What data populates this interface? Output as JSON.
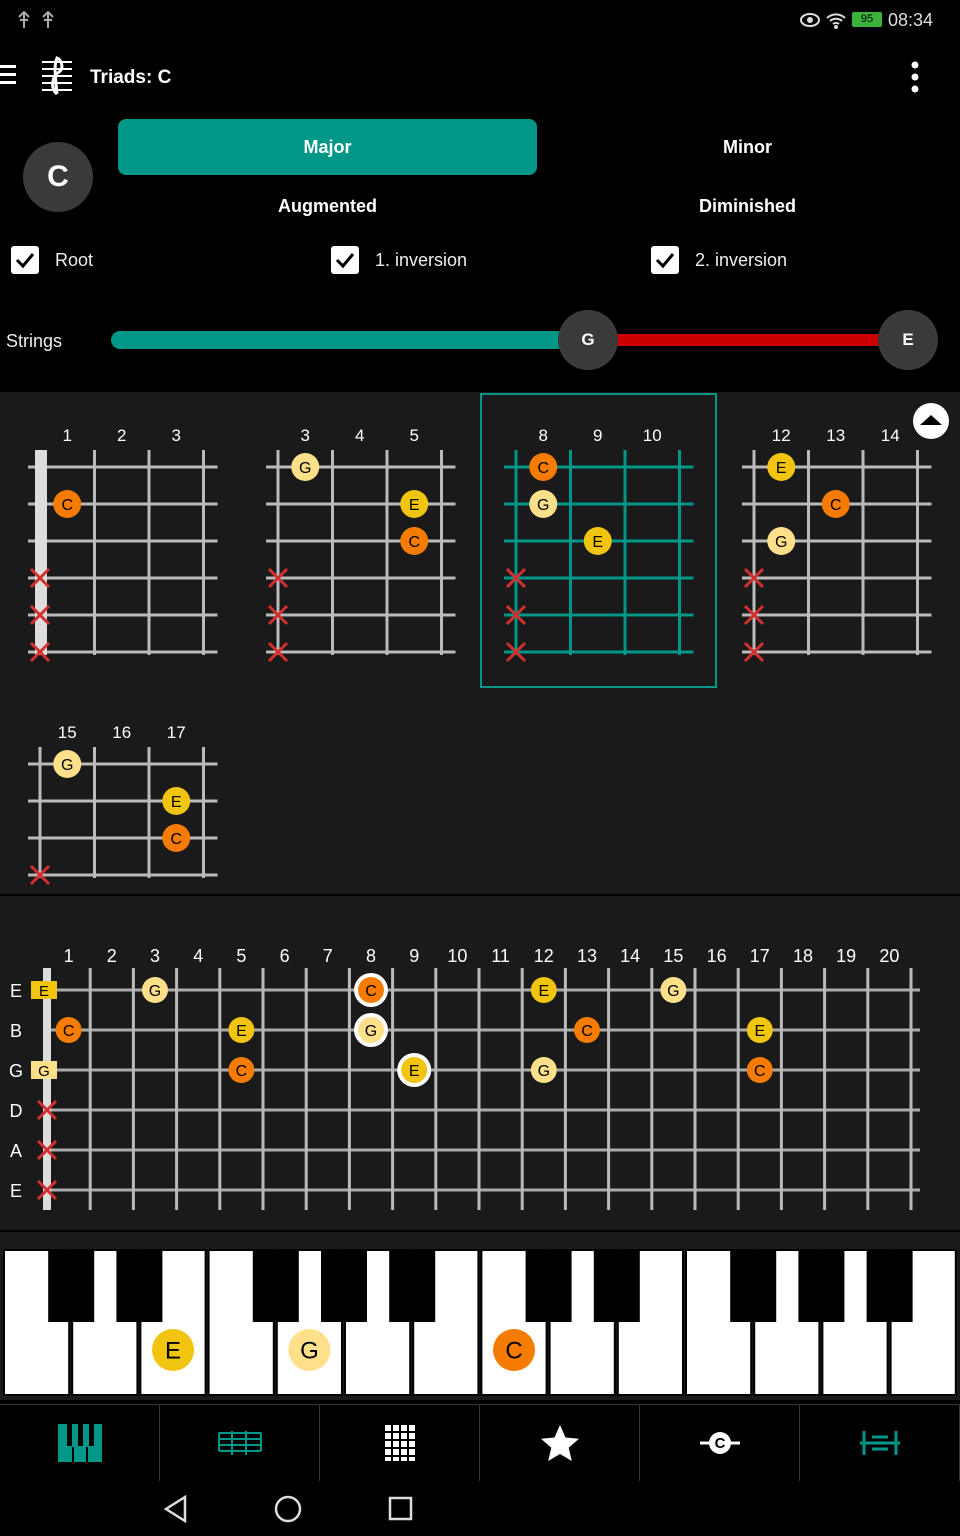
{
  "status": {
    "battery": "95",
    "time": "08:34"
  },
  "appbar": {
    "title": "Triads: C"
  },
  "root_note": "C",
  "chord_types": {
    "major": "Major",
    "minor": "Minor",
    "augmented": "Augmented",
    "diminished": "Diminished"
  },
  "inversions": {
    "root": "Root",
    "first": "1. inversion",
    "second": "2. inversion"
  },
  "strings_control": {
    "label": "Strings",
    "low_handle": "G",
    "high_handle": "E"
  },
  "colors": {
    "accent": "#009688",
    "root": "#f57c00",
    "third": "#f1c40f",
    "fifth": "#ffe08a",
    "mute": "#d32f2f",
    "muted_range": "#cc0000"
  },
  "diagrams": [
    {
      "frets": [
        "1",
        "2",
        "3"
      ],
      "selected": false
    },
    {
      "frets": [
        "3",
        "4",
        "5"
      ],
      "selected": false
    },
    {
      "frets": [
        "8",
        "9",
        "10"
      ],
      "selected": true
    },
    {
      "frets": [
        "12",
        "13",
        "14"
      ],
      "selected": false
    },
    {
      "frets": [
        "15",
        "16",
        "17"
      ],
      "selected": false
    }
  ],
  "fretboard": {
    "fret_numbers": [
      "1",
      "2",
      "3",
      "4",
      "5",
      "6",
      "7",
      "8",
      "9",
      "10",
      "11",
      "12",
      "13",
      "14",
      "15",
      "16",
      "17",
      "18",
      "19",
      "20"
    ],
    "string_names": [
      "E",
      "B",
      "G",
      "D",
      "A",
      "E"
    ]
  },
  "piano": {
    "key_labels": [
      "E",
      "G",
      "C"
    ]
  },
  "bottom_nav": [
    "piano-icon",
    "score-icon",
    "grid-icon",
    "star-icon",
    "chord-root-icon",
    "guitar-icon"
  ]
}
